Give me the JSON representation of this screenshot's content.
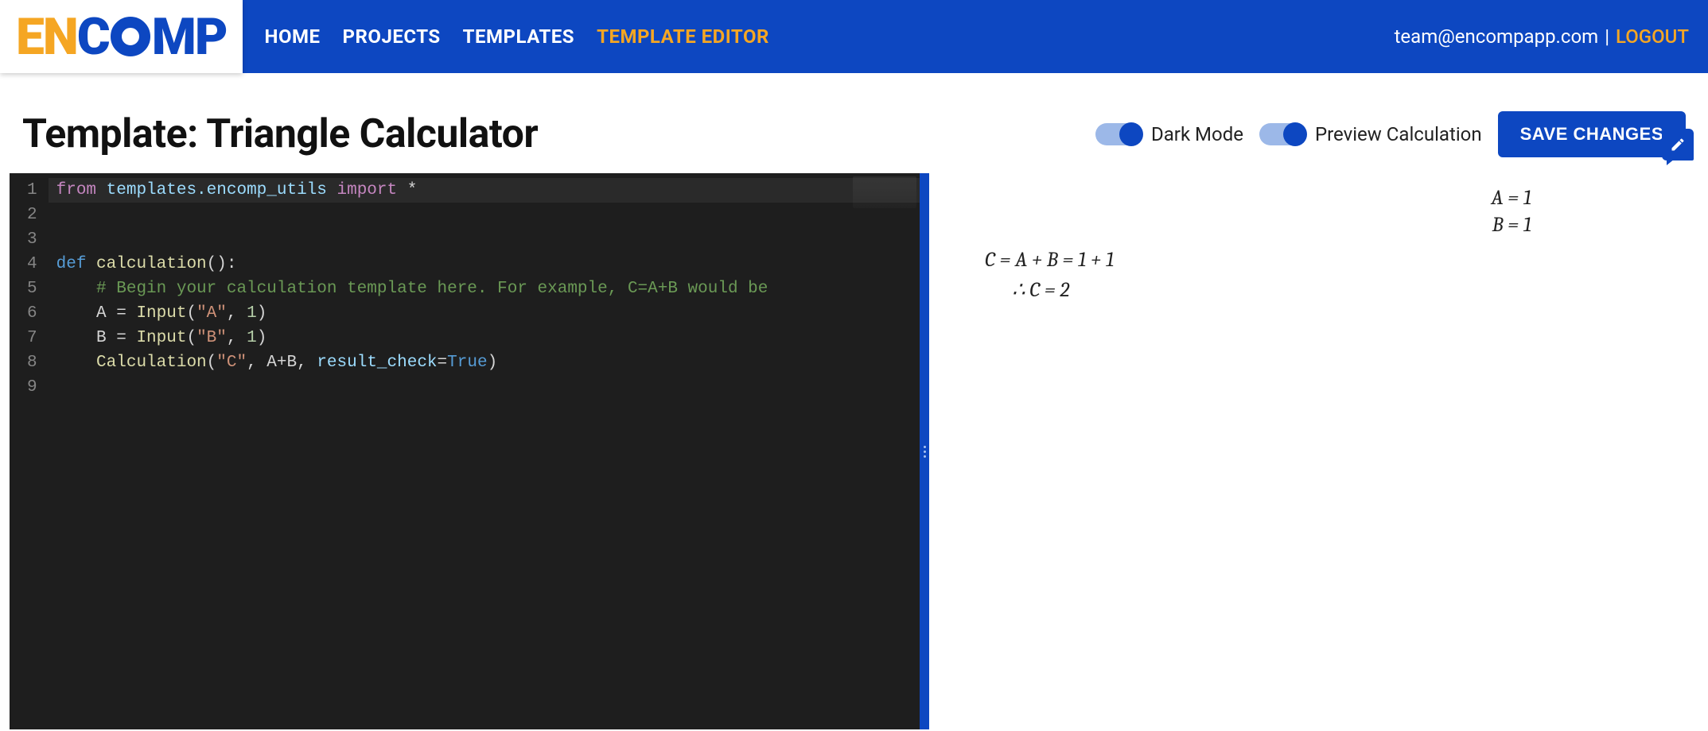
{
  "nav": {
    "logo_en": "EN",
    "logo_c": "C",
    "logo_mp": "MP",
    "links": [
      "HOME",
      "PROJECTS",
      "TEMPLATES",
      "TEMPLATE EDITOR"
    ],
    "active_index": 3,
    "user_email": "team@encompapp.com",
    "logout": "LOGOUT",
    "sep": "|"
  },
  "toolbar": {
    "title": "Template: Triangle Calculator",
    "dark_mode_label": "Dark Mode",
    "preview_label": "Preview Calculation",
    "save_label": "SAVE CHANGES",
    "dark_mode_on": true,
    "preview_on": true
  },
  "editor": {
    "line_numbers": [
      "1",
      "2",
      "3",
      "4",
      "5",
      "6",
      "7",
      "8",
      "9"
    ],
    "code_lines": [
      {
        "n": 1,
        "hl": true,
        "tokens": [
          [
            "kw",
            "from"
          ],
          [
            "pn",
            " "
          ],
          [
            "id",
            "templates.encomp_utils"
          ],
          [
            "pn",
            " "
          ],
          [
            "kw",
            "import"
          ],
          [
            "pn",
            " *"
          ]
        ]
      },
      {
        "n": 2,
        "tokens": []
      },
      {
        "n": 3,
        "tokens": []
      },
      {
        "n": 4,
        "tokens": [
          [
            "fn",
            "def"
          ],
          [
            "pn",
            " "
          ],
          [
            "name",
            "calculation"
          ],
          [
            "pn",
            "():"
          ]
        ]
      },
      {
        "n": 5,
        "tokens": [
          [
            "pn",
            "    "
          ],
          [
            "com",
            "# Begin your calculation template here. For example, C=A+B would be"
          ]
        ]
      },
      {
        "n": 6,
        "tokens": [
          [
            "pn",
            "    A "
          ],
          [
            "pn",
            "="
          ],
          [
            "pn",
            " "
          ],
          [
            "name",
            "Input"
          ],
          [
            "pn",
            "("
          ],
          [
            "str",
            "\"A\""
          ],
          [
            "pn",
            ", "
          ],
          [
            "num",
            "1"
          ],
          [
            "pn",
            ")"
          ]
        ]
      },
      {
        "n": 7,
        "tokens": [
          [
            "pn",
            "    B "
          ],
          [
            "pn",
            "="
          ],
          [
            "pn",
            " "
          ],
          [
            "name",
            "Input"
          ],
          [
            "pn",
            "("
          ],
          [
            "str",
            "\"B\""
          ],
          [
            "pn",
            ", "
          ],
          [
            "num",
            "1"
          ],
          [
            "pn",
            ")"
          ]
        ]
      },
      {
        "n": 8,
        "tokens": [
          [
            "pn",
            "    "
          ],
          [
            "name",
            "Calculation"
          ],
          [
            "pn",
            "("
          ],
          [
            "str",
            "\"C\""
          ],
          [
            "pn",
            ", A"
          ],
          [
            "pn",
            "+"
          ],
          [
            "pn",
            "B, "
          ],
          [
            "id",
            "result_check"
          ],
          [
            "pn",
            "="
          ],
          [
            "bool",
            "True"
          ],
          [
            "pn",
            ")"
          ]
        ]
      },
      {
        "n": 9,
        "tokens": []
      }
    ]
  },
  "preview": {
    "eq_a": "A = 1",
    "eq_b": "B = 1",
    "eq_c_line": "C = A + B = 1  + 1",
    "eq_result": "∴ C = 2"
  }
}
